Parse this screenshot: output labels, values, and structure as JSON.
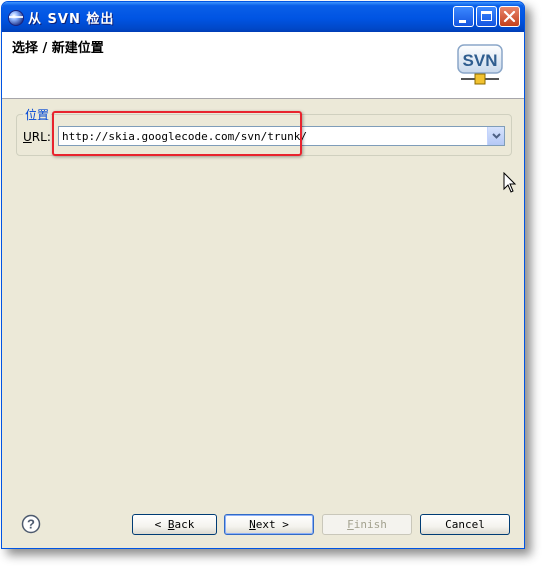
{
  "window": {
    "title": "从 SVN 检出"
  },
  "banner": {
    "title": "选择 / 新建位置",
    "logo_text": "SVN"
  },
  "location": {
    "group_label": "位置",
    "url_label_key": "U",
    "url_label_rest": "RL:",
    "url_value": "http://skia.googlecode.com/svn/trunk/"
  },
  "buttons": {
    "back_prefix": "< ",
    "back_key": "B",
    "back_rest": "ack",
    "next_key": "N",
    "next_rest": "ext >",
    "finish_key": "F",
    "finish_rest": "inish",
    "cancel": "Cancel"
  },
  "colors": {
    "title_bar": "#0054e3",
    "dialog_bg": "#ece9d8",
    "highlight": "#e8242e",
    "group_label": "#0046d5"
  }
}
